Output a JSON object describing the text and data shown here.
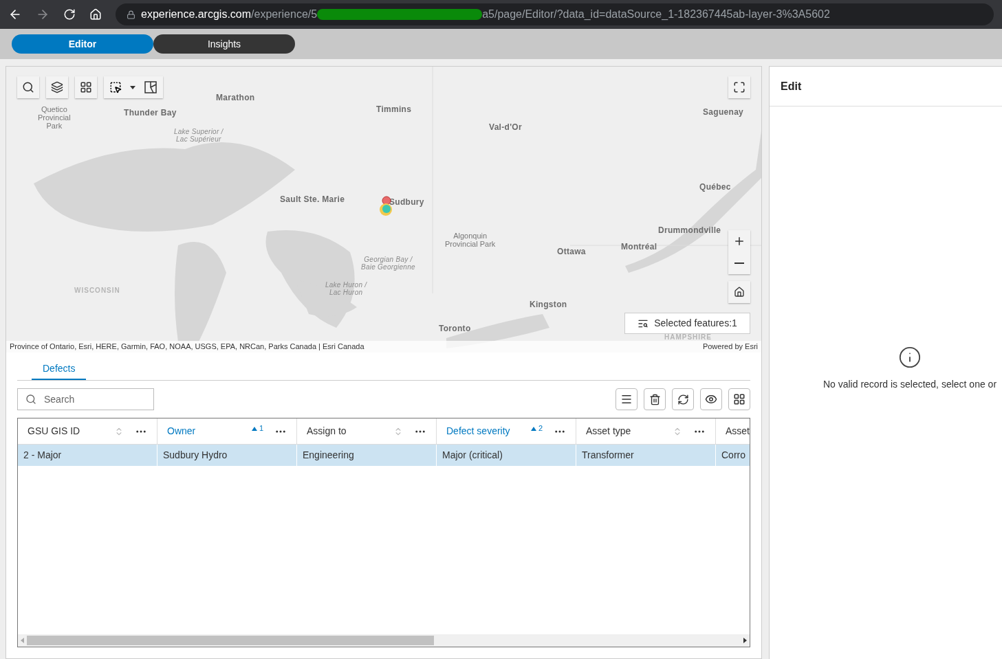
{
  "browser": {
    "url_host": "experience.arcgis.com",
    "url_path_start": "/experience/5",
    "url_path_end": "a5/page/Editor/?data_id=dataSource_1-182367445ab-layer-3%3A5602"
  },
  "tabs": [
    {
      "label": "Editor",
      "selected": true
    },
    {
      "label": "Insights",
      "selected": false
    }
  ],
  "map": {
    "labels": [
      {
        "text": "Quetico\nProvincial\nPark",
        "kind": "park"
      },
      {
        "text": "Thunder Bay",
        "kind": "city"
      },
      {
        "text": "Marathon",
        "kind": "city"
      },
      {
        "text": "Lake Superior /\nLac Supérieur",
        "kind": "water"
      },
      {
        "text": "Timmins",
        "kind": "city"
      },
      {
        "text": "Val-d'Or",
        "kind": "city"
      },
      {
        "text": "Saguenay",
        "kind": "city"
      },
      {
        "text": "Québec",
        "kind": "city"
      },
      {
        "text": "Sault Ste. Marie",
        "kind": "city"
      },
      {
        "text": "Sudbury",
        "kind": "city"
      },
      {
        "text": "Algonquin\nProvincial Park",
        "kind": "park"
      },
      {
        "text": "Drummondville",
        "kind": "city"
      },
      {
        "text": "Montréal",
        "kind": "city"
      },
      {
        "text": "Ottawa",
        "kind": "city"
      },
      {
        "text": "Georgian Bay /\nBaie Georgienne",
        "kind": "water"
      },
      {
        "text": "WISCONSIN",
        "kind": "region"
      },
      {
        "text": "Lake Huron /\nLac Huron",
        "kind": "water"
      },
      {
        "text": "Kingston",
        "kind": "city"
      },
      {
        "text": "Toronto",
        "kind": "city"
      },
      {
        "text": "HAMPSHIRE",
        "kind": "region"
      }
    ],
    "selected_features": "Selected features:1",
    "attribution": "Province of Ontario, Esri, HERE, Garmin, FAO, NOAA, USGS, EPA, NRCan, Parks Canada | Esri Canada",
    "powered_by": "Powered by Esri"
  },
  "table_tabs": [
    {
      "label": "Defects",
      "selected": true
    }
  ],
  "search": {
    "placeholder": "Search"
  },
  "table": {
    "columns": [
      {
        "label": "GSU GIS ID",
        "sorted": false
      },
      {
        "label": "Owner",
        "sorted": true,
        "sort_rank": "1"
      },
      {
        "label": "Assign to",
        "sorted": false
      },
      {
        "label": "Defect severity",
        "sorted": true,
        "sort_rank": "2"
      },
      {
        "label": "Asset type",
        "sorted": false
      },
      {
        "label": "Asset",
        "sorted": false
      }
    ],
    "rows": [
      {
        "selected": true,
        "cells": [
          "2 - Major",
          "Sudbury Hydro",
          "Engineering",
          "Major (critical)",
          "Transformer",
          "Corro"
        ]
      }
    ]
  },
  "edit_panel": {
    "title": "Edit",
    "message": "No valid record is selected, select one or"
  }
}
